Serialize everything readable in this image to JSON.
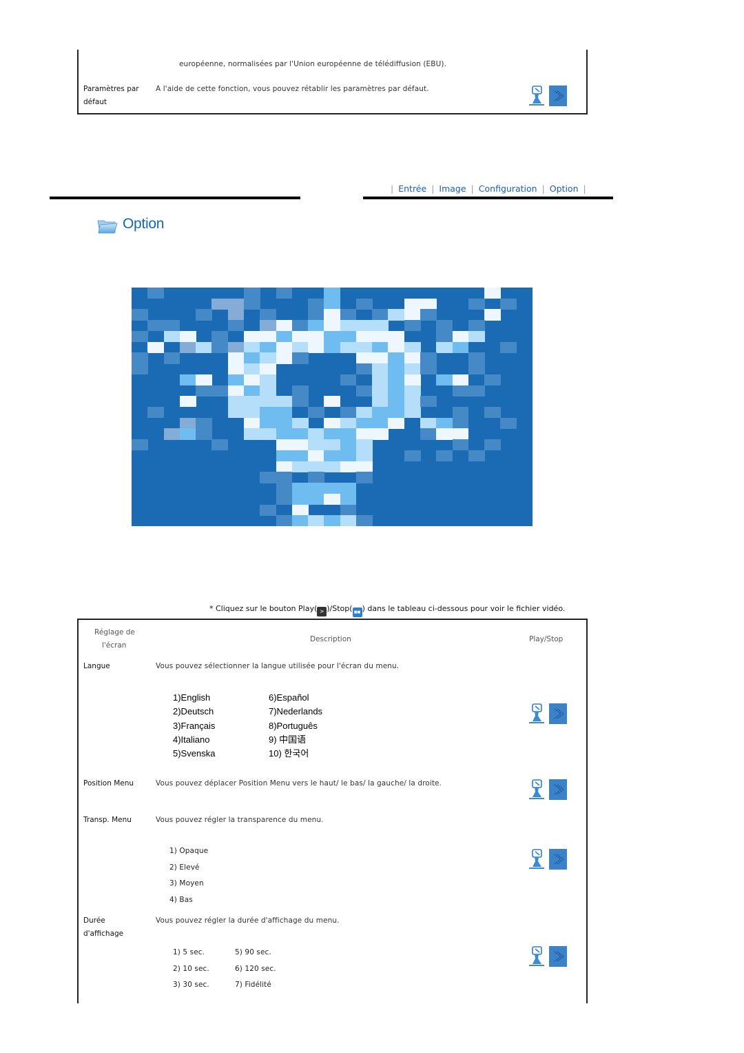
{
  "top_section": {
    "continued_text": "européenne, normalisées par l'Union européenne de télédiffusion (EBU).",
    "row": {
      "setting": [
        "Paramètres par",
        "défaut"
      ],
      "description": "A l'aide de cette fonction, vous pouvez rétablir les paramètres par défaut."
    }
  },
  "nav": {
    "items": [
      "Entrée",
      "Image",
      "Configuration",
      "Option"
    ]
  },
  "page_title": "Option",
  "icons": {
    "folder": "folder-icon",
    "play_figure": "monitor-person-icon",
    "play_button": "play-arrow-icon"
  },
  "mosaic": {
    "colors": [
      "#1a6bb3",
      "#4589c6",
      "#85acd6",
      "#6fbdf0",
      "#b5defa",
      "#eef7fe"
    ],
    "rows": [
      "0100000101003000000000500",
      "0000022100013010055001010",
      "1000102010015101451000500",
      "0110001025135444010101000",
      "1045010553553355500154000",
      "0502412435453443540430010",
      "1010005345100055351001000",
      "1000005450000014341001000",
      "0003503540000104350350100",
      "0000115340100014340011000",
      "0005004444105004341000000",
      "0100004433010143340010100",
      "0002100533405433504310010",
      "0023100443343355001550000",
      "1000010005544340000010100",
      "0000000003353340010101000",
      "0000000005444550000000000",
      "0000000011010010000000000",
      "0000000001333300000000000",
      "0000000001335300000000000",
      "0000000010500100000000000",
      "0000000001343410000000000"
    ]
  },
  "note": {
    "prefix": "* Cliquez sur le bouton Play(",
    "middle": ")/Stop(",
    "suffix": ") dans le tableau ci-dessous pour voir le fichier vidéo.",
    "play_glyph": ">",
    "stop_glyph": "■■"
  },
  "table": {
    "headers": {
      "setting": [
        "Réglage de",
        "l'écran"
      ],
      "description": "Description",
      "play_stop": "Play/Stop"
    },
    "rows": [
      {
        "setting": [
          "Langue"
        ],
        "description": "Vous pouvez sélectionner la langue utilisée pour l'écran du menu.",
        "languages_left": [
          "1)English",
          "2)Deutsch",
          "3)Français",
          "4)Italiano",
          "5)Svenska"
        ],
        "languages_right": [
          "6)Español",
          "7)Nederlands",
          "8)Português",
          "9) 中国语",
          "10) 한국어"
        ]
      },
      {
        "setting": [
          "Position Menu"
        ],
        "description": "Vous pouvez déplacer Position Menu vers le haut/ le bas/ la gauche/ la droite."
      },
      {
        "setting": [
          "Transp. Menu"
        ],
        "description": "Vous pouvez régler la transparence du menu.",
        "options": [
          "1) Opaque",
          "2) Elevé",
          "3) Moyen",
          "4) Bas"
        ]
      },
      {
        "setting": [
          "Durée",
          "d'affichage"
        ],
        "description": "Vous pouvez régler la durée d'affichage du menu.",
        "options_left": [
          "1) 5 sec.",
          "2) 10 sec.",
          "3) 30 sec."
        ],
        "options_right": [
          "5) 90 sec.",
          "6) 120 sec.",
          "7) Fidélité"
        ]
      }
    ]
  }
}
